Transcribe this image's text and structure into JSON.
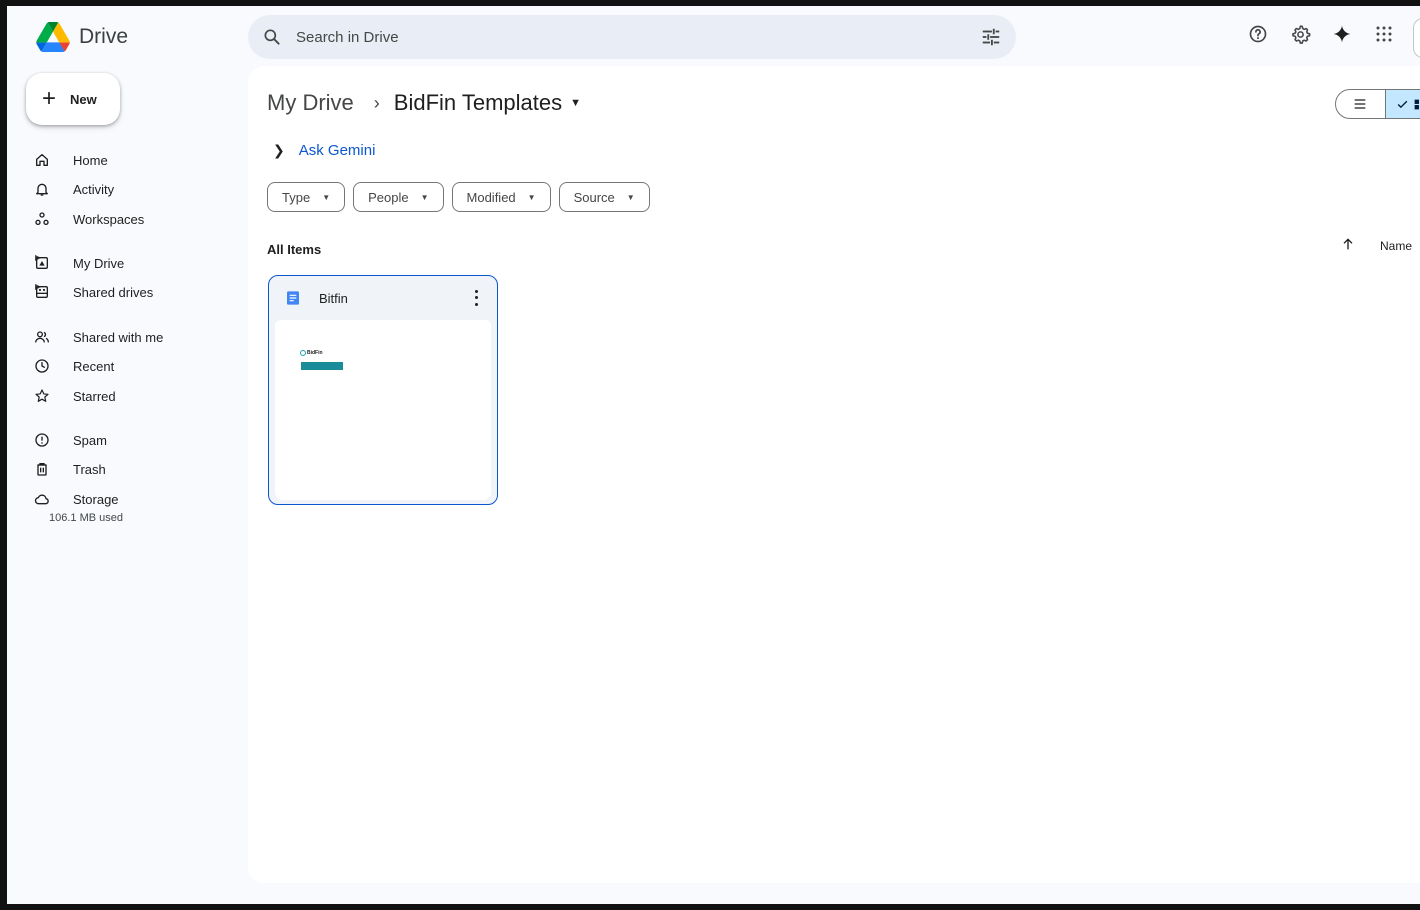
{
  "app": {
    "name": "Drive",
    "accent": "#0b57d0",
    "selected_bg": "#c2e7ff"
  },
  "search": {
    "placeholder": "Search in Drive",
    "value": ""
  },
  "sidebar": {
    "new_label": "New",
    "items": [
      {
        "label": "Home",
        "icon": "home-icon"
      },
      {
        "label": "Activity",
        "icon": "bell-icon"
      },
      {
        "label": "Workspaces",
        "icon": "workspaces-icon"
      },
      {
        "label": "My Drive",
        "icon": "my-drive-icon"
      },
      {
        "label": "Shared drives",
        "icon": "shared-drives-icon"
      },
      {
        "label": "Shared with me",
        "icon": "people-icon"
      },
      {
        "label": "Recent",
        "icon": "clock-icon"
      },
      {
        "label": "Starred",
        "icon": "star-icon"
      },
      {
        "label": "Spam",
        "icon": "spam-icon"
      },
      {
        "label": "Trash",
        "icon": "trash-icon"
      },
      {
        "label": "Storage",
        "icon": "cloud-icon"
      }
    ],
    "storage_used": "106.1 MB used"
  },
  "breadcrumb": {
    "parent": "My Drive",
    "current": "BidFin Templates"
  },
  "gemini": {
    "label": "Ask Gemini"
  },
  "filters": [
    "Type",
    "People",
    "Modified",
    "Source"
  ],
  "list": {
    "heading": "All Items",
    "sort_label": "Name"
  },
  "files": [
    {
      "name": "Bitfin",
      "type_icon": "google-docs-icon",
      "thumb_logo": "BidFin"
    }
  ]
}
